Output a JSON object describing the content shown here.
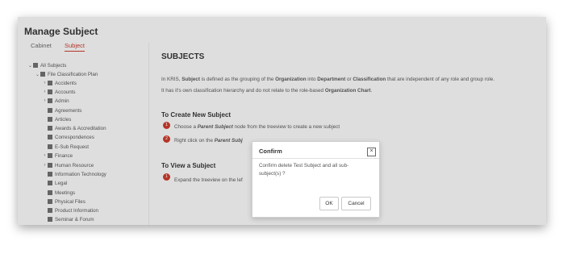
{
  "page": {
    "title": "Manage Subject"
  },
  "tabs": [
    {
      "label": "Cabinet",
      "active": false
    },
    {
      "label": "Subject",
      "active": true
    }
  ],
  "tree": {
    "root": "All Subjects",
    "plan": "File Classification Plan",
    "items": [
      "Accidents",
      "Accounts",
      "Admin",
      "Agreements",
      "Articles",
      "Awards & Accreditation",
      "Correspondences",
      "E-Sub Request",
      "Finance",
      "Human Resource",
      "Information Technology",
      "Legal",
      "Meetings",
      "Physical Files",
      "Product Information",
      "Seminar & Forum"
    ]
  },
  "content": {
    "heading": "SUBJECTS",
    "intro1": {
      "a": "In KRIS, ",
      "b": "Subject",
      "c": " is defined as the grouping of the ",
      "d": "Organization",
      "e": " into ",
      "f": "Department",
      "g": " or ",
      "h": "Classification",
      "i": " that are independent of any role and group role."
    },
    "intro2": {
      "a": "It has it's own classification hierarchy and do not relate to the role-based ",
      "b": "Organization Chart",
      "c": "."
    },
    "create": {
      "title": "To Create New Subject",
      "step1": {
        "num": "1",
        "a": "Choose a ",
        "b": "Parent Subject",
        "c": " node from the treeview to create a new subject"
      },
      "step2": {
        "num": "2",
        "a": "Right click on the ",
        "b": "Parent Subj"
      }
    },
    "view": {
      "title": "To View a Subject",
      "step1": {
        "num": "1",
        "text": "Expand the treeview on the lef"
      }
    }
  },
  "modal": {
    "title": "Confirm",
    "close": "×",
    "message": "Confirm delete Test Subject and all sub-subject(s) ?",
    "ok": "OK",
    "cancel": "Cancel"
  }
}
